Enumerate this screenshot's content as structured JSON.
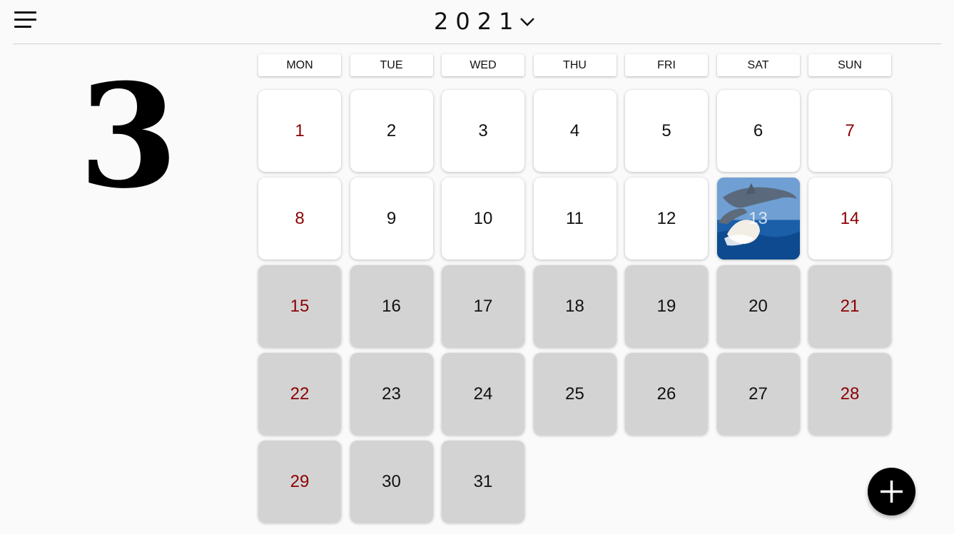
{
  "header": {
    "year": "2021",
    "menu_icon": "hamburger-menu-icon",
    "year_dropdown_icon": "chevron-down-icon"
  },
  "month": {
    "number": "3"
  },
  "weekdays": [
    "MON",
    "TUE",
    "WED",
    "THU",
    "FRI",
    "SAT",
    "SUN"
  ],
  "days": [
    {
      "label": "1",
      "weekend": true,
      "past": false
    },
    {
      "label": "2",
      "weekend": false,
      "past": false
    },
    {
      "label": "3",
      "weekend": false,
      "past": false
    },
    {
      "label": "4",
      "weekend": false,
      "past": false
    },
    {
      "label": "5",
      "weekend": false,
      "past": false
    },
    {
      "label": "6",
      "weekend": false,
      "past": false
    },
    {
      "label": "7",
      "weekend": true,
      "past": false
    },
    {
      "label": "8",
      "weekend": true,
      "past": false
    },
    {
      "label": "9",
      "weekend": false,
      "past": false
    },
    {
      "label": "10",
      "weekend": false,
      "past": false
    },
    {
      "label": "11",
      "weekend": false,
      "past": false
    },
    {
      "label": "12",
      "weekend": false,
      "past": false
    },
    {
      "label": "13",
      "weekend": false,
      "past": false,
      "photo": true
    },
    {
      "label": "14",
      "weekend": true,
      "past": false
    },
    {
      "label": "15",
      "weekend": true,
      "past": true
    },
    {
      "label": "16",
      "weekend": false,
      "past": true
    },
    {
      "label": "17",
      "weekend": false,
      "past": true
    },
    {
      "label": "18",
      "weekend": false,
      "past": true
    },
    {
      "label": "19",
      "weekend": false,
      "past": true
    },
    {
      "label": "20",
      "weekend": false,
      "past": true
    },
    {
      "label": "21",
      "weekend": true,
      "past": true
    },
    {
      "label": "22",
      "weekend": true,
      "past": true
    },
    {
      "label": "23",
      "weekend": false,
      "past": true
    },
    {
      "label": "24",
      "weekend": false,
      "past": true
    },
    {
      "label": "25",
      "weekend": false,
      "past": true
    },
    {
      "label": "26",
      "weekend": false,
      "past": true
    },
    {
      "label": "27",
      "weekend": false,
      "past": true
    },
    {
      "label": "28",
      "weekend": true,
      "past": true
    },
    {
      "label": "29",
      "weekend": true,
      "past": true
    },
    {
      "label": "30",
      "weekend": false,
      "past": true
    },
    {
      "label": "31",
      "weekend": false,
      "past": true
    }
  ],
  "colors": {
    "weekend_text": "#8b0000",
    "future_cell": "#ffffff",
    "past_cell": "#d3d3d3",
    "fab": "#000000"
  },
  "fab": {
    "icon": "plus-icon"
  }
}
